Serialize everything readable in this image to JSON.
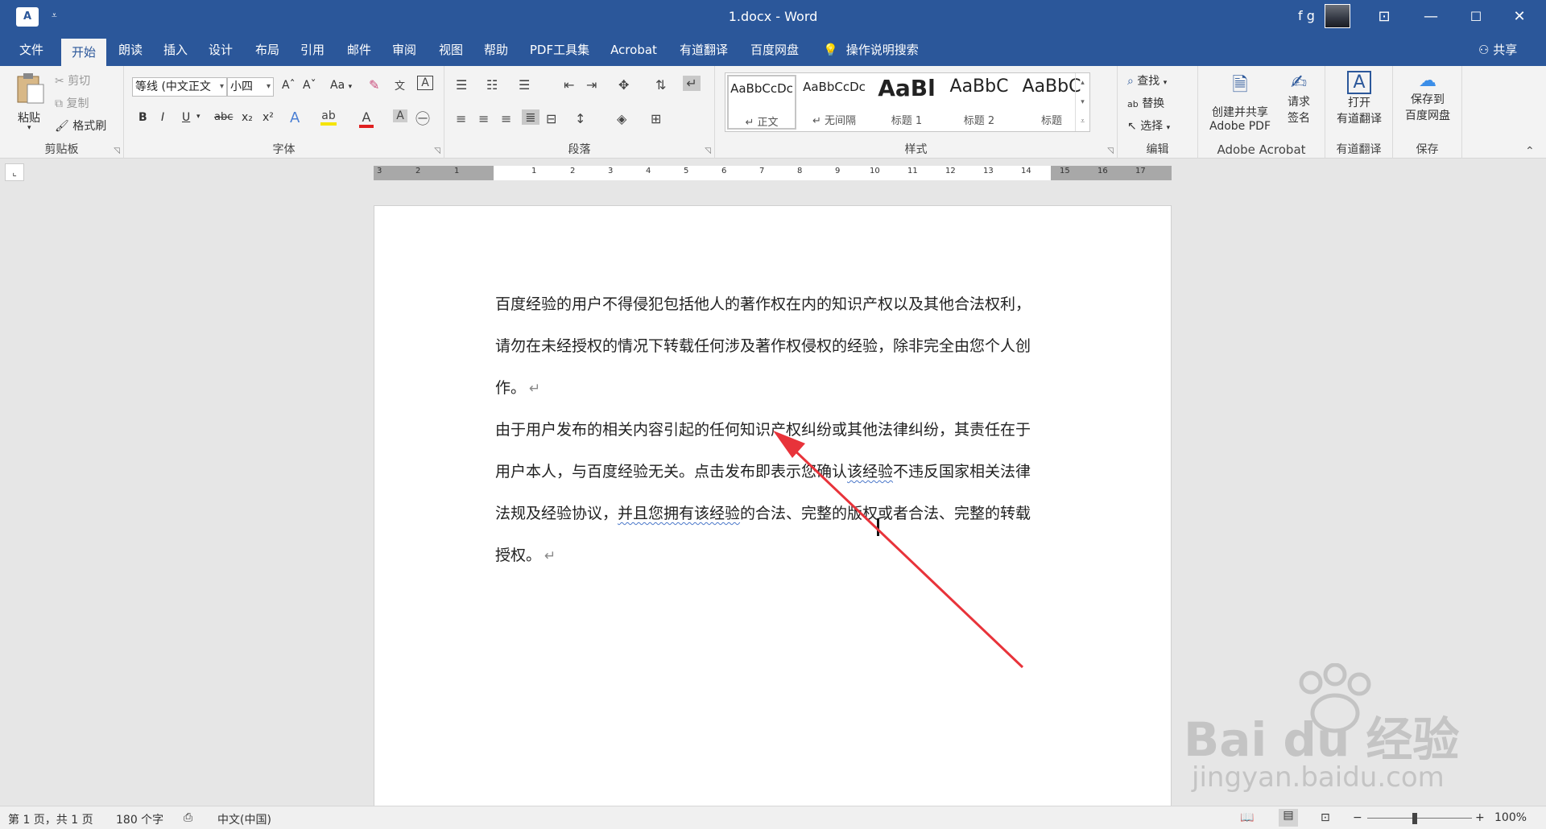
{
  "window": {
    "title": "1.docx  -  Word",
    "user_name": "f g",
    "app_icon_letter": "A",
    "qa_dropdown": "⩡",
    "ribbon_display": "⊡",
    "minimize": "—",
    "maximize": "☐",
    "close": "✕"
  },
  "menu": {
    "tabs": [
      "文件",
      "开始",
      "朗读",
      "插入",
      "设计",
      "布局",
      "引用",
      "邮件",
      "审阅",
      "视图",
      "帮助",
      "PDF工具集",
      "Acrobat",
      "有道翻译",
      "百度网盘"
    ],
    "active_tab": "开始",
    "tell_me": "操作说明搜索",
    "share": "共享"
  },
  "ribbon": {
    "clipboard": {
      "label": "剪贴板",
      "paste": "粘贴",
      "cut": "剪切",
      "copy": "复制",
      "format_painter": "格式刷"
    },
    "font": {
      "label": "字体",
      "font_name": "等线 (中文正文",
      "font_size": "小四",
      "grow": "Aˆ",
      "shrink": "Aˇ",
      "change_case": "Aa",
      "bold": "B",
      "italic": "I",
      "underline": "U",
      "strike": "abc",
      "subscript": "x₂",
      "superscript": "x²"
    },
    "paragraph": {
      "label": "段落"
    },
    "styles": {
      "label": "样式",
      "items": [
        {
          "sample": "AaBbCcDc",
          "name": "↵ 正文"
        },
        {
          "sample": "AaBbCcDc",
          "name": "↵ 无间隔"
        },
        {
          "sample": "AaBl",
          "name": "标题 1"
        },
        {
          "sample": "AaBbC",
          "name": "标题 2"
        },
        {
          "sample": "AaBbC",
          "name": "标题"
        }
      ]
    },
    "editing": {
      "label": "编辑",
      "find": "查找",
      "replace": "替换",
      "select": "选择"
    },
    "acrobat": {
      "label": "Adobe Acrobat",
      "create_share_1": "创建并共享",
      "create_share_2": "Adobe PDF",
      "request_1": "请求",
      "request_2": "签名"
    },
    "youdao": {
      "label": "有道翻译",
      "open_1": "打开",
      "open_2": "有道翻译"
    },
    "save": {
      "label": "保存",
      "save_1": "保存到",
      "save_2": "百度网盘"
    }
  },
  "ruler": {
    "left_numbers": [
      "3",
      "2",
      "1"
    ],
    "right_numbers": [
      "1",
      "2",
      "3",
      "4",
      "5",
      "6",
      "7",
      "8",
      "9",
      "10",
      "11",
      "12",
      "13",
      "14"
    ],
    "far_numbers": [
      "15",
      "16",
      "17"
    ]
  },
  "document": {
    "paragraph1": {
      "lines": [
        "百度经验的用户不得侵犯包括他人的著作权在内的知识产权以及其他合法权利，",
        "请勿在未经授权的情况下转载任何涉及著作权侵权的经验，除非完全由您个人创",
        "作。"
      ]
    },
    "paragraph2": {
      "line1": "由于用户发布的相关内容引起的任何知识产权纠纷或其他法律纠纷，其责任在于",
      "line2_a": "用户本人，与百度经验无关。点击发布即表示您确认",
      "line2_b": "该经验",
      "line2_c": "不违反国家相关法律",
      "line3_a": "法规及经验协议，",
      "line3_b": "并且您拥有该经验",
      "line3_c": "的合法、完整的版权或者合法、完整的转载",
      "line4": "授权。"
    },
    "paragraph_mark": "↵"
  },
  "watermark": {
    "brand": "Bai du 经验",
    "url": "jingyan.baidu.com"
  },
  "status": {
    "page": "第 1 页，共 1 页",
    "words": "180 个字",
    "language": "中文(中国)",
    "zoom_minus": "−",
    "zoom_plus": "+",
    "zoom": "100%",
    "zoom_fraction": 0.45
  },
  "colors": {
    "word_blue": "#2b579a",
    "arrow_red": "#e8333a"
  }
}
